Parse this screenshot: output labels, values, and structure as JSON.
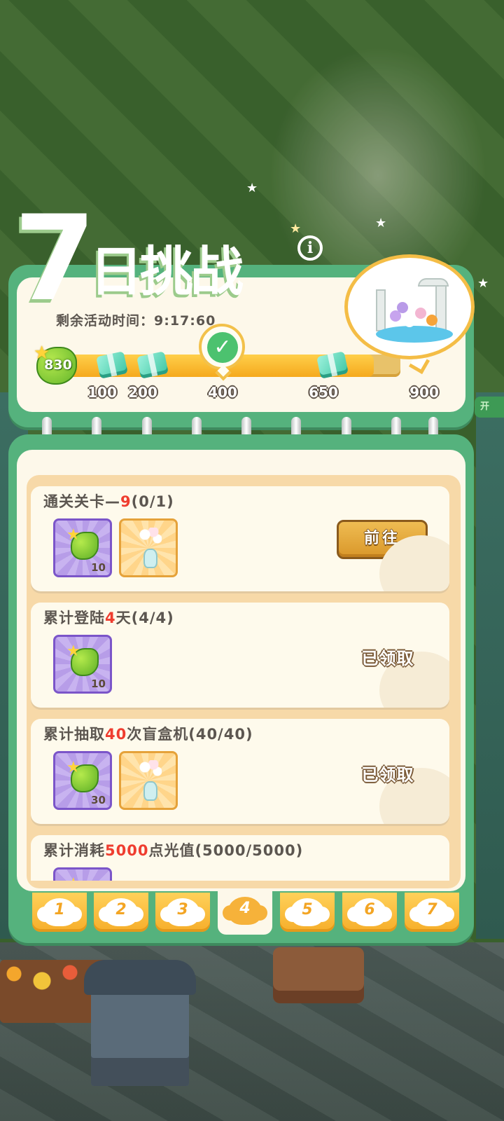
{
  "title": {
    "seven": "7",
    "text": "日挑战"
  },
  "timer": {
    "label": "剩余活动时间：",
    "value": "9:17:60"
  },
  "progress": {
    "current_points": "830",
    "max_points": 900,
    "fraction": 0.92,
    "milestones": [
      {
        "label": "100",
        "value": 100,
        "reward": "gift-icon"
      },
      {
        "label": "200",
        "value": 200,
        "reward": "gift-icon"
      },
      {
        "label": "400",
        "value": 400,
        "reward": "flower-bouquet-icon",
        "claimed": true
      },
      {
        "label": "650",
        "value": 650,
        "reward": "gift-icon"
      },
      {
        "label": "900",
        "value": 900,
        "reward": "garden-fountain-icon"
      }
    ]
  },
  "tasks": [
    {
      "title_pre": "通关关卡—",
      "title_hl": "9",
      "title_post": "(0/1)",
      "rewards": [
        {
          "icon": "leaf-star-icon",
          "qty": "10"
        },
        {
          "icon": "flower-vase-icon",
          "qty": ""
        }
      ],
      "action": "前往",
      "status": "go"
    },
    {
      "title_pre": "累计登陆",
      "title_hl": "4",
      "title_post": "天(4/4)",
      "rewards": [
        {
          "icon": "leaf-star-icon",
          "qty": "10"
        }
      ],
      "action": "已领取",
      "status": "claimed"
    },
    {
      "title_pre": "累计抽取",
      "title_hl": "40",
      "title_post": "次盲盒机(40/40)",
      "rewards": [
        {
          "icon": "leaf-star-icon",
          "qty": "30"
        },
        {
          "icon": "flower-vase-icon",
          "qty": ""
        }
      ],
      "action": "已领取",
      "status": "claimed"
    },
    {
      "title_pre": "累计消耗",
      "title_hl": "5000",
      "title_post": "点光值(5000/5000)",
      "rewards": [
        {
          "icon": "leaf-star-icon",
          "qty": ""
        }
      ],
      "action": "",
      "status": "partial"
    }
  ],
  "day_tabs": [
    {
      "label": "1",
      "active": false
    },
    {
      "label": "2",
      "active": false
    },
    {
      "label": "3",
      "active": false
    },
    {
      "label": "4",
      "active": true
    },
    {
      "label": "5",
      "active": false
    },
    {
      "label": "6",
      "active": false
    },
    {
      "label": "7",
      "active": false
    }
  ],
  "colors": {
    "panel_green": "#55b27d",
    "panel_cream": "#fdf8ea",
    "highlight_red": "#ef3d2f",
    "bar_orange": "#f5a91d",
    "tab_yellow": "#ffd15a"
  }
}
